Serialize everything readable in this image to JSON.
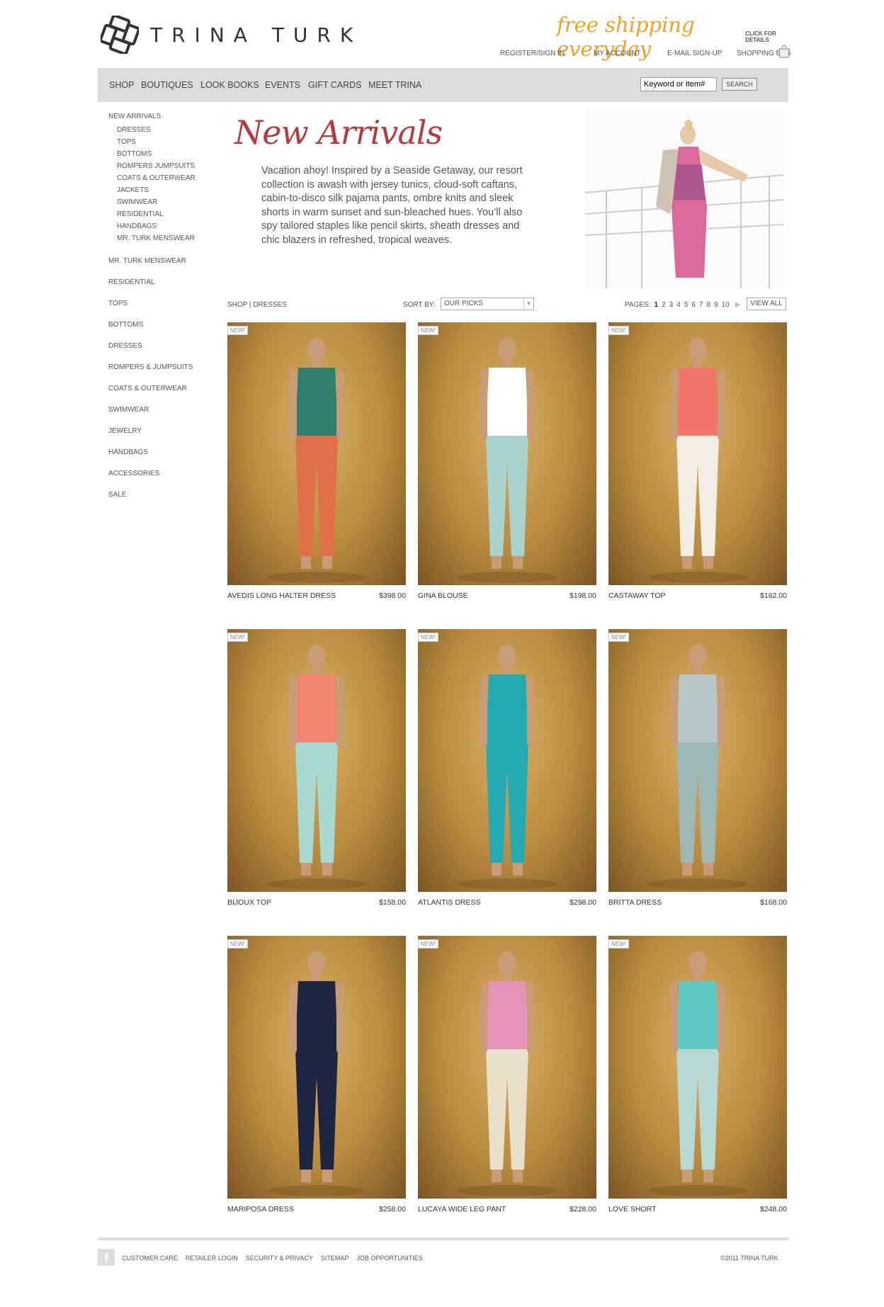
{
  "header": {
    "brand": "TRINA TURK",
    "promo_text": "free shipping everyday",
    "promo_link": "CLICK FOR DETAILS",
    "util_links": [
      "REGISTER/SIGN IN",
      "MY ACCOUNT",
      "E-MAIL SIGN-UP",
      "SHOPPING BAG"
    ]
  },
  "nav": {
    "items": [
      "SHOP",
      "BOUTIQUES",
      "LOOK BOOKS",
      "EVENTS",
      "GIFT CARDS",
      "MEET TRINA"
    ],
    "search_placeholder": "Keyword or Item#",
    "search_button": "SEARCH"
  },
  "sidebar": {
    "new_arrivals": "NEW ARRIVALS",
    "sub_items": [
      "DRESSES",
      "TOPS",
      "BOTTOMS",
      "ROMPERS JUMPSUITS",
      "COATS & OUTERWEAR",
      "JACKETS",
      "SWIMWEAR",
      "RESIDENTIAL",
      "HANDBAGS",
      "MR. TURK MENSWEAR"
    ],
    "items": [
      "MR. TURK MENSWEAR",
      "RESIDENTIAL",
      "TOPS",
      "BOTTOMS",
      "DRESSES",
      "ROMPERS & JUMPSUITS",
      "COATS & OUTERWEAR",
      "SWIMWEAR",
      "JEWELRY",
      "HANDBAGS",
      "ACCESSORIES",
      "SALE"
    ]
  },
  "hero": {
    "title": "New Arrivals",
    "text": "Vacation ahoy! Inspired by a Seaside Getaway, our resort collection is awash with jersey tunics, cloud-soft caftans, cabin-to-disco silk pajama pants, ombre knits and sleek shorts in warm sunset and sun-bleached hues. You’ll also spy tailored staples like pencil skirts, sheath dresses and chic blazers in refreshed, tropical weaves."
  },
  "toolbar": {
    "breadcrumb": "SHOP | DRESSES",
    "sort_label": "SORT BY:",
    "sort_value": "OUR PICKS",
    "pages_label": "PAGES:",
    "pages": [
      "1",
      "2",
      "3",
      "4",
      "5",
      "6",
      "7",
      "8",
      "9",
      "10"
    ],
    "current_page": "1",
    "view_all": "VIEW ALL"
  },
  "products": [
    {
      "badge": "NEW!",
      "name": "AVEDIS LONG HALTER DRESS",
      "price": "$398.00"
    },
    {
      "badge": "NEW!",
      "name": "GINA BLOUSE",
      "price": "$198.00"
    },
    {
      "badge": "NEW!",
      "name": "CASTAWAY TOP",
      "price": "$162.00"
    },
    {
      "badge": "NEW!",
      "name": "BIJOUX TOP",
      "price": "$158.00"
    },
    {
      "badge": "NEW!",
      "name": "ATLANTIS DRESS",
      "price": "$298.00"
    },
    {
      "badge": "NEW!",
      "name": "BRITTA DRESS",
      "price": "$168.00"
    },
    {
      "badge": "NEW!",
      "name": "MARIPOSA DRESS",
      "price": "$258.00"
    },
    {
      "badge": "NEW!",
      "name": "LUCAYA WIDE LEG PANT",
      "price": "$228.00"
    },
    {
      "badge": "NEW!",
      "name": "LOVE SHORT",
      "price": "$248.00"
    }
  ],
  "footer": {
    "links": [
      "CUSTOMER CARE",
      "RETAILER LOGIN",
      "SECURITY & PRIVACY",
      "SITEMAP",
      "JOB OPPORTUNITIES"
    ],
    "copyright": "©2011 TRINA TURK"
  },
  "colors": {
    "accent_orange": "#f0a022",
    "title_red": "#b53a3a",
    "nav_bg": "#dcdcdc"
  }
}
